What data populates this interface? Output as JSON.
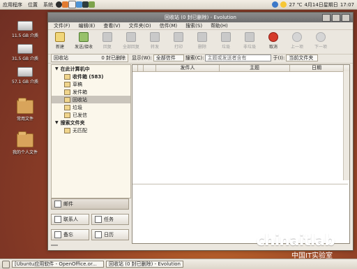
{
  "topbar": {
    "menus": [
      "应用程序",
      "位置",
      "系统"
    ],
    "date": "4月14日星期日",
    "time": "17:07",
    "temp": "27 ℃"
  },
  "desktop": {
    "icons": [
      {
        "label": "11.5 GB 介质"
      },
      {
        "label": "31.5 GB 介质"
      },
      {
        "label": "57.1 GB 介质"
      },
      {
        "label": "常用文件"
      },
      {
        "label": "我的个人文件"
      }
    ]
  },
  "window": {
    "title": "回收站 (0 封已删除) - Evolution",
    "menu": [
      "文件(F)",
      "编辑(E)",
      "查看(V)",
      "文件夹(O)",
      "信件(M)",
      "搜索(S)",
      "帮助(H)"
    ],
    "toolbar": [
      {
        "label": "新建",
        "state": "enabled"
      },
      {
        "label": "发送/接收",
        "state": "enabled"
      },
      {
        "label": "回复",
        "state": "disabled"
      },
      {
        "label": "全部回复",
        "state": "disabled"
      },
      {
        "label": "转发",
        "state": "disabled"
      },
      {
        "label": "打印",
        "state": "disabled"
      },
      {
        "label": "删除",
        "state": "disabled"
      },
      {
        "label": "垃圾",
        "state": "disabled"
      },
      {
        "label": "非垃圾",
        "state": "disabled"
      },
      {
        "label": "取消",
        "state": "enabled"
      },
      {
        "label": "上一项",
        "state": "disabled"
      },
      {
        "label": "下一项",
        "state": "disabled"
      }
    ],
    "folder": {
      "name": "回收站",
      "count": "0 封已删除"
    },
    "filters": {
      "show_label": "显示(W):",
      "show_value": "全部信件",
      "search_label": "搜索(C):",
      "search_placeholder": "主题或发送者含有",
      "in_label": "于(I):",
      "in_value": "当前文件夹"
    },
    "tree": {
      "local_label": "在此计算机中",
      "items": [
        {
          "label": "收件箱 (583)",
          "bold": true
        },
        {
          "label": "草稿"
        },
        {
          "label": "发件箱"
        },
        {
          "label": "回收站",
          "selected": true
        },
        {
          "label": "垃圾"
        },
        {
          "label": "已发信"
        }
      ],
      "search_folders_label": "搜索文件夹",
      "search_items": [
        {
          "label": "无匹配"
        }
      ]
    },
    "columns": [
      "发件人",
      "主题",
      "日期"
    ],
    "switcher": {
      "mail": "邮件",
      "contacts": "联系人",
      "tasks": "任务",
      "memo": "备忘",
      "calendar": "日历"
    }
  },
  "taskbar": {
    "items": [
      "[Ubuntu应用软件 - OpenOffice.or...",
      "回收站 (0 封已删除) - Evolution"
    ]
  },
  "watermark": {
    "brand": "chinaitlab",
    "domain": "中国IT实验室"
  }
}
